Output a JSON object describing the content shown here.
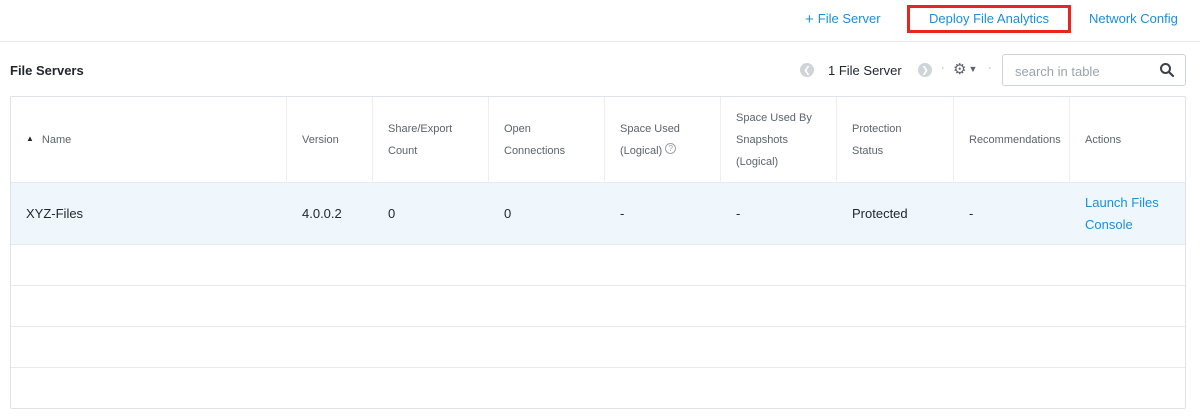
{
  "toolbar": {
    "add_file_server_label": "File Server",
    "deploy_file_analytics_label": "Deploy File Analytics",
    "network_config_label": "Network Config"
  },
  "section": {
    "title": "File Servers"
  },
  "pager": {
    "count_label": "1 File Server"
  },
  "search": {
    "placeholder": "search in table",
    "value": ""
  },
  "table": {
    "columns": [
      {
        "lines": [
          "Name"
        ],
        "sorted": "ascending"
      },
      {
        "lines": [
          "Version"
        ]
      },
      {
        "lines": [
          "Share/Export",
          "Count"
        ]
      },
      {
        "lines": [
          "Open",
          "Connections"
        ]
      },
      {
        "lines": [
          "Space Used",
          "(Logical)"
        ],
        "help": true
      },
      {
        "lines": [
          "Space Used By",
          "Snapshots",
          "(Logical)"
        ]
      },
      {
        "lines": [
          "Protection",
          "Status"
        ]
      },
      {
        "lines": [
          "Recommendations"
        ]
      },
      {
        "lines": [
          "Actions"
        ]
      }
    ],
    "rows": [
      {
        "name": "XYZ-Files",
        "version": "4.0.0.2",
        "share_export_count": "0",
        "open_connections": "0",
        "space_used_logical": "-",
        "space_used_by_snapshots_logical": "-",
        "protection_status": "Protected",
        "recommendations": "-",
        "actions": [
          "Launch Files",
          "Console"
        ]
      }
    ]
  },
  "icons": {
    "add": "plus-icon",
    "prev": "chevron-left-icon",
    "next": "chevron-right-icon",
    "settings": "gear-icon",
    "search": "search-icon",
    "help": "help-circle-icon",
    "sort": "sort-ascending-icon"
  },
  "colors": {
    "link": "#1b8fd9",
    "highlight_border": "#e8261f",
    "selected_row": "#f0f7fc"
  }
}
